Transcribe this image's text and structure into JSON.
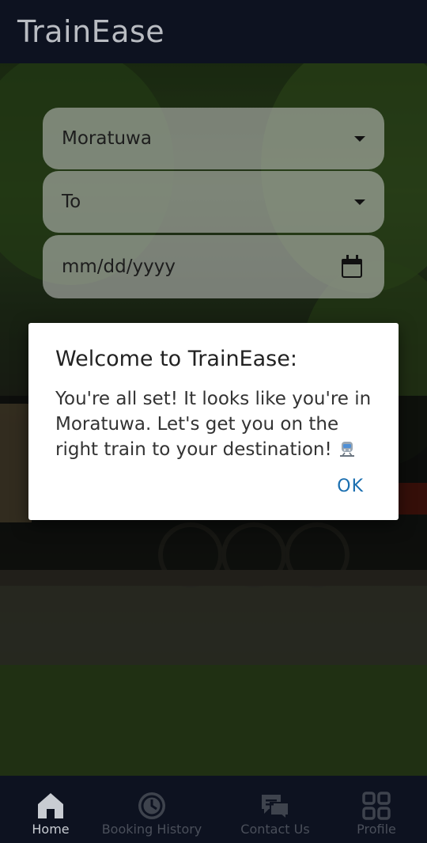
{
  "app": {
    "title": "TrainEase"
  },
  "search": {
    "from_value": "Moratuwa",
    "to_placeholder": "To",
    "date_placeholder": "mm/dd/yyyy"
  },
  "dialog": {
    "title": "Welcome to TrainEase:",
    "message": "You're all set! It looks like you're in Moratuwa. Let's get you on the right train to your destination!",
    "ok_label": "OK"
  },
  "nav": {
    "items": [
      {
        "label": "Home",
        "icon": "home-icon",
        "active": true
      },
      {
        "label": "Booking History",
        "icon": "clock-icon",
        "active": false
      },
      {
        "label": "Contact Us",
        "icon": "chat-icon",
        "active": false
      },
      {
        "label": "Profile",
        "icon": "grid-icon",
        "active": false
      }
    ]
  },
  "colors": {
    "accent": "#1b6fb0",
    "bar_bg": "#0d1220",
    "dialog_bg": "#ffffff"
  }
}
